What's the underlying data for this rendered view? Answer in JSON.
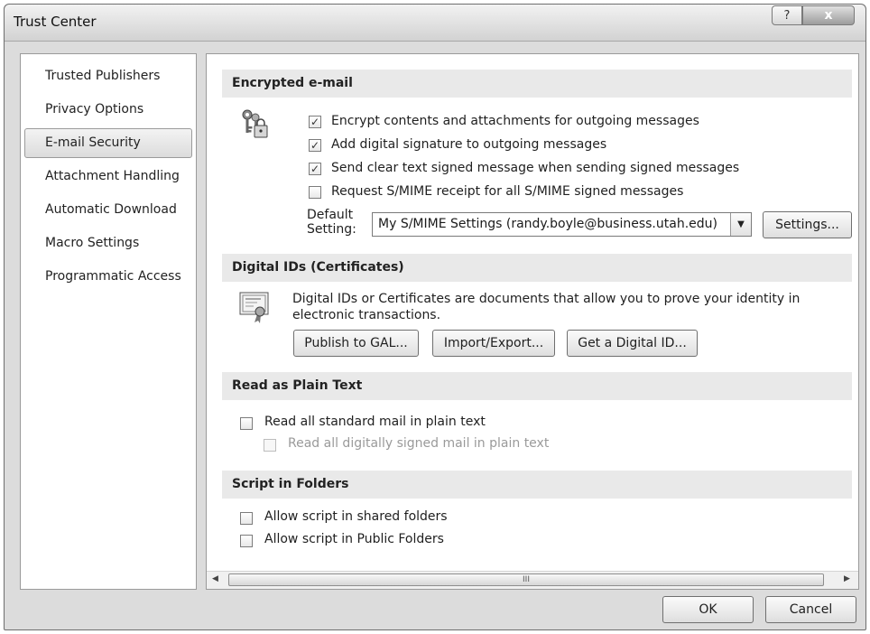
{
  "window": {
    "title": "Trust Center",
    "help_glyph": "?",
    "close_glyph": "x"
  },
  "sidebar": {
    "items": [
      {
        "label": "Trusted Publishers",
        "selected": false
      },
      {
        "label": "Privacy Options",
        "selected": false
      },
      {
        "label": "E-mail Security",
        "selected": true
      },
      {
        "label": "Attachment Handling",
        "selected": false
      },
      {
        "label": "Automatic Download",
        "selected": false
      },
      {
        "label": "Macro Settings",
        "selected": false
      },
      {
        "label": "Programmatic Access",
        "selected": false
      }
    ]
  },
  "encrypted": {
    "header": "Encrypted e-mail",
    "options": [
      {
        "label": "Encrypt contents and attachments for outgoing messages",
        "checked": true
      },
      {
        "label": "Add digital signature to outgoing messages",
        "checked": true
      },
      {
        "label": "Send clear text signed message when sending signed messages",
        "checked": true
      },
      {
        "label": "Request S/MIME receipt for all S/MIME signed messages",
        "checked": false
      }
    ],
    "default_label_1": "Default",
    "default_label_2": "Setting:",
    "default_value": "My S/MIME Settings (randy.boyle@business.utah.edu)",
    "settings_button": "Settings..."
  },
  "digital_ids": {
    "header": "Digital IDs (Certificates)",
    "description_1": "Digital IDs or Certificates are documents that allow you to prove your identity in",
    "description_2": "electronic transactions.",
    "publish_button": "Publish to GAL...",
    "import_button": "Import/Export...",
    "get_button": "Get a Digital ID..."
  },
  "plain_text": {
    "header": "Read as Plain Text",
    "read_all": {
      "label": "Read all standard mail in plain text",
      "checked": false
    },
    "read_signed": {
      "label": "Read all digitally signed mail in plain text",
      "checked": false,
      "enabled": false
    }
  },
  "script": {
    "header": "Script in Folders",
    "shared": {
      "label": "Allow script in shared folders",
      "checked": false
    },
    "public": {
      "label": "Allow script in Public Folders",
      "checked": false
    }
  },
  "scrollbar": {
    "left_arrow": "◀",
    "right_arrow": "▶",
    "grip": "III"
  },
  "footer": {
    "ok": "OK",
    "cancel": "Cancel"
  }
}
